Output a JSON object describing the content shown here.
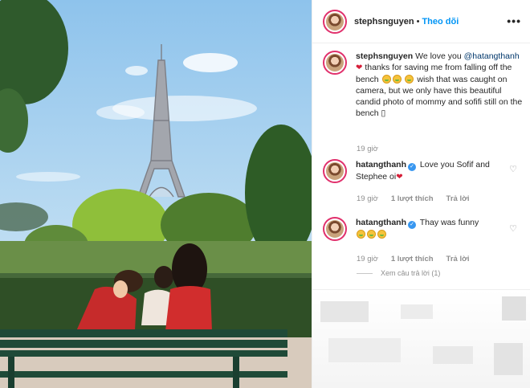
{
  "post": {
    "username": "stephsnguyen",
    "separator": "•",
    "follow_label": "Theo dõi",
    "more_label": "•••"
  },
  "caption": {
    "username": "stephsnguyen",
    "text_1": "We love you",
    "mention": "@hatangthanh",
    "text_2": "thanks for saving me from falling off the bench",
    "text_3": "wish that was caught on camera, but we only have this beautiful candid photo of mommy and sofifi still on the bench",
    "text_4": "▯",
    "time": "19 giờ"
  },
  "comments": [
    {
      "username": "hatangthanh",
      "verified": "✓",
      "text": "Love you Sofif and Stephee oi",
      "time": "19 giờ",
      "likes": "1 lượt thích",
      "reply": "Trả lời",
      "like_icon": "heart-outline-icon"
    },
    {
      "username": "hatangthanh",
      "verified": "✓",
      "text": "Thay was funny",
      "time": "19 giờ",
      "likes": "1 lượt thích",
      "reply": "Trả lời",
      "like_icon": "heart-outline-icon"
    }
  ],
  "view_replies": "Xem câu trả lời (1)",
  "colors": {
    "follow": "#0095f6",
    "link": "#00376b",
    "muted": "#8e8e8e",
    "story_ring": "#e1306c"
  }
}
